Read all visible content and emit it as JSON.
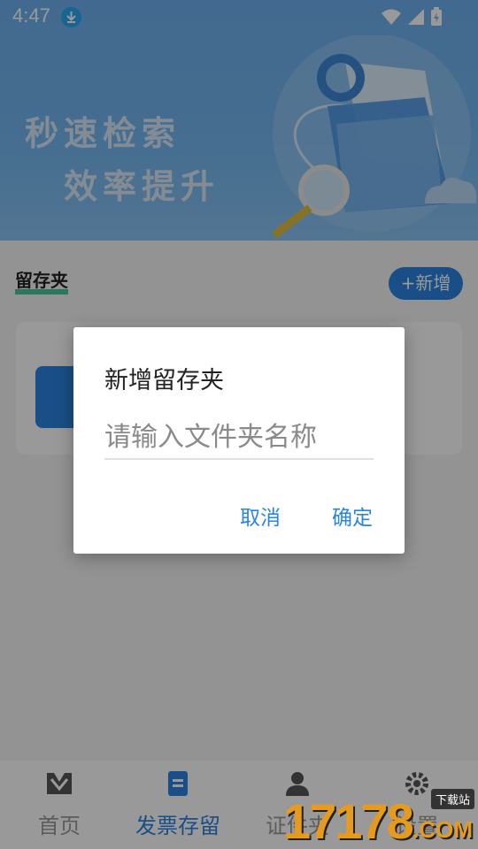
{
  "status_bar": {
    "time": "4:47"
  },
  "banner": {
    "line1": "秒速检索",
    "line2": "效率提升"
  },
  "section": {
    "title": "留存夹",
    "add_button": "+新增"
  },
  "nav": {
    "items": [
      {
        "label": "首页",
        "icon": "m-logo-icon"
      },
      {
        "label": "发票存留",
        "icon": "document-icon"
      },
      {
        "label": "证件夹",
        "icon": "person-icon"
      },
      {
        "label": "设置",
        "icon": "gear-icon"
      }
    ],
    "active_index": 1
  },
  "dialog": {
    "title": "新增留存夹",
    "input_placeholder": "请输入文件夹名称",
    "cancel_label": "取消",
    "ok_label": "确定"
  },
  "watermark": {
    "number": "17178",
    "tag": "下载站",
    "domain": ".COM"
  },
  "colors": {
    "accent": "#2a84e0",
    "banner": "#73b7f0",
    "underline": "#46c8a0"
  }
}
